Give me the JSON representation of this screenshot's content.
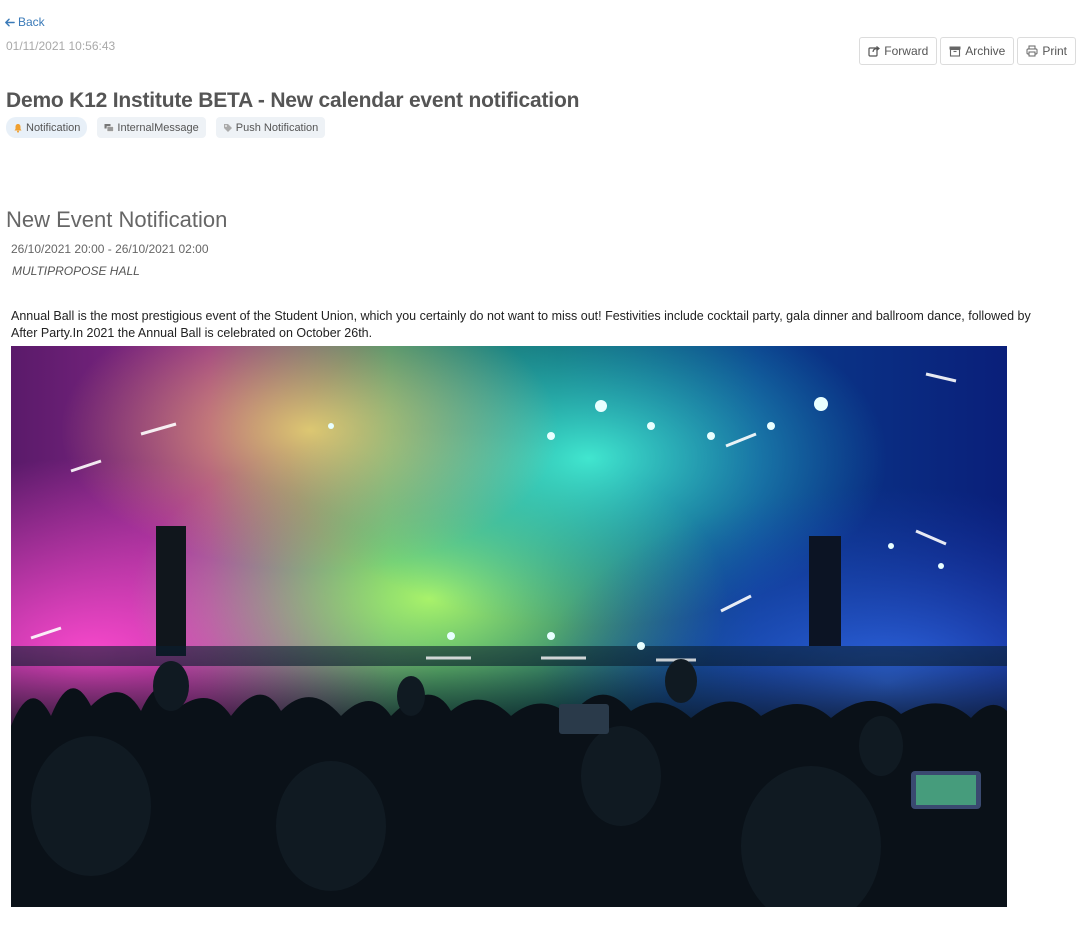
{
  "nav": {
    "back_label": "Back"
  },
  "message": {
    "timestamp": "01/11/2021 10:56:43",
    "title": "Demo K12 Institute BETA - New calendar event notification"
  },
  "toolbar": {
    "forward_label": "Forward",
    "archive_label": "Archive",
    "print_label": "Print"
  },
  "tags": [
    {
      "label": "Notification",
      "icon": "bell-icon"
    },
    {
      "label": "InternalMessage",
      "icon": "messages-icon"
    },
    {
      "label": "Push Notification",
      "icon": "tag-icon"
    }
  ],
  "event": {
    "heading": "New Event Notification",
    "date_range": "26/10/2021 20:00 - 26/10/2021 02:00",
    "location": "MULTIPROPOSE HALL",
    "description": "Annual Ball is the most prestigious event of the Student Union, which you certainly do not want to miss out! Festivities include cocktail party, gala dinner and ballroom dance, followed by After Party.In 2021 the Annual Ball is celebrated on October 26th.",
    "image_subject": "concert-crowd-photo"
  },
  "colors": {
    "link": "#3a7ab8",
    "tag_bg": "#eef2f6",
    "bell": "#f0a030"
  }
}
